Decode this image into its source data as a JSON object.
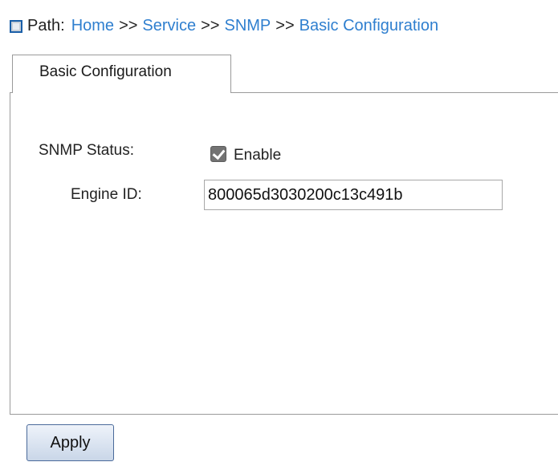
{
  "breadcrumb": {
    "icon": "page-icon",
    "prefix": "Path:",
    "separator": ">>",
    "items": [
      "Home",
      "Service",
      "SNMP",
      "Basic Configuration"
    ]
  },
  "tabs": [
    {
      "label": "Basic Configuration",
      "active": true
    }
  ],
  "form": {
    "snmp_status": {
      "label": "SNMP Status:",
      "checkbox_label": "Enable",
      "checked": true
    },
    "engine_id": {
      "label": "Engine ID:",
      "value": "800065d3030200c13c491b"
    }
  },
  "actions": {
    "apply_label": "Apply"
  },
  "colors": {
    "link": "#2f7fcf",
    "border": "#9a9a9a",
    "checkbox": "#737373"
  }
}
